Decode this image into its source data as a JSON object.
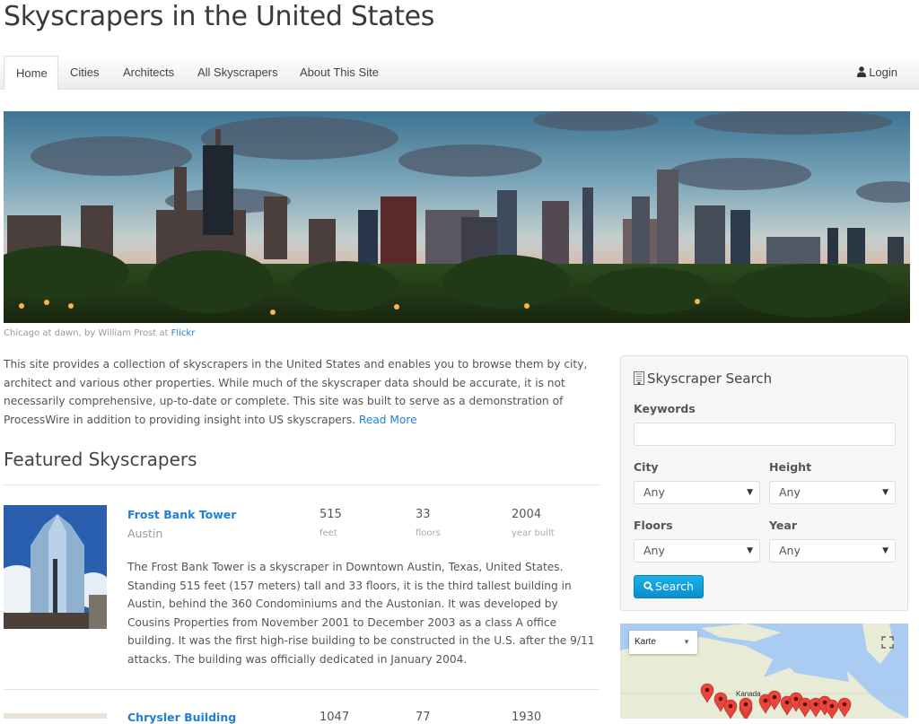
{
  "site": {
    "title": "Skyscrapers in the United States"
  },
  "nav": {
    "items": [
      {
        "label": "Home",
        "active": true
      },
      {
        "label": "Cities",
        "active": false
      },
      {
        "label": "Architects",
        "active": false
      },
      {
        "label": "All Skyscrapers",
        "active": false
      },
      {
        "label": "About This Site",
        "active": false
      }
    ],
    "login_label": "Login",
    "login_icon": "user-icon"
  },
  "hero": {
    "alt": "Chicago skyline at dawn",
    "caption_text": "Chicago at dawn, by William Prost at ",
    "caption_link": "Flickr"
  },
  "intro": {
    "text": "This site provides a collection of skyscrapers in the United States and enables you to browse them by city, architect and various other properties. While much of the skyscraper data should be accurate, it is not necessarily comprehensive, up-to-date or complete. This site was built to serve as a demonstration of ProcessWire in addition to providing insight into US skyscrapers. ",
    "read_more": "Read More"
  },
  "featured": {
    "heading": "Featured Skyscrapers",
    "items": [
      {
        "name": "Frost Bank Tower",
        "city": "Austin",
        "height": "515",
        "height_label": "feet",
        "floors": "33",
        "floors_label": "floors",
        "year": "2004",
        "year_label": "year built",
        "description": "The Frost Bank Tower is a skyscraper in Downtown Austin, Texas, United States. Standing 515 feet (157 meters) tall and 33 floors, it is the third tallest building in Austin, behind the 360 Condominiums and the Austonian. It was developed by Cousins Properties from November 2001 to December 2003 as a class A office building. It was the first high-rise building to be constructed in the U.S. after the 9/11 attacks. The building was officially dedicated in January 2004."
      },
      {
        "name": "Chrysler Building",
        "height": "1047",
        "floors": "77",
        "year": "1930"
      }
    ]
  },
  "search": {
    "title": "Skyscraper Search",
    "title_icon": "building-icon",
    "keywords_label": "Keywords",
    "keywords_value": "",
    "city_label": "City",
    "city_value": "Any",
    "height_label": "Height",
    "height_value": "Any",
    "floors_label": "Floors",
    "floors_value": "Any",
    "year_label": "Year",
    "year_value": "Any",
    "button_label": "Search",
    "button_color": "#0f9ad8"
  },
  "map": {
    "type_label": "Karte",
    "country_label": "Kanada",
    "marker_color": "#e8463c"
  }
}
